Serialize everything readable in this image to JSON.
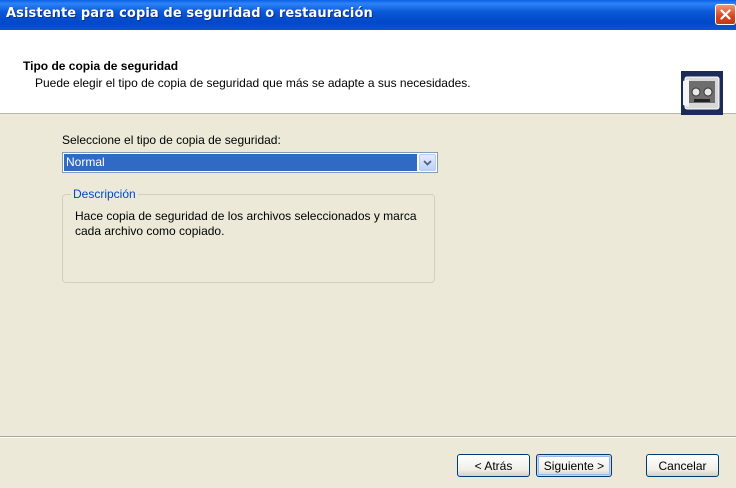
{
  "window": {
    "title": "Asistente para copia de seguridad o restauración"
  },
  "header": {
    "title": "Tipo de copia de seguridad",
    "subtitle": "Puede elegir el tipo de copia de seguridad que más se adapte a sus necesidades.",
    "icon": "backup-tape-icon"
  },
  "backup_type": {
    "label": "Seleccione el tipo de copia de seguridad:",
    "selected": "Normal"
  },
  "description": {
    "legend": "Descripción",
    "text": "Hace copia de seguridad de los archivos seleccionados y marca cada archivo como copiado."
  },
  "buttons": {
    "back": "< Atrás",
    "next": "Siguiente >",
    "cancel": "Cancelar"
  },
  "colors": {
    "titlebar": "#0a58d8",
    "selection": "#316ac5",
    "legend": "#0046d5",
    "dialog_bg": "#ece9d8"
  }
}
